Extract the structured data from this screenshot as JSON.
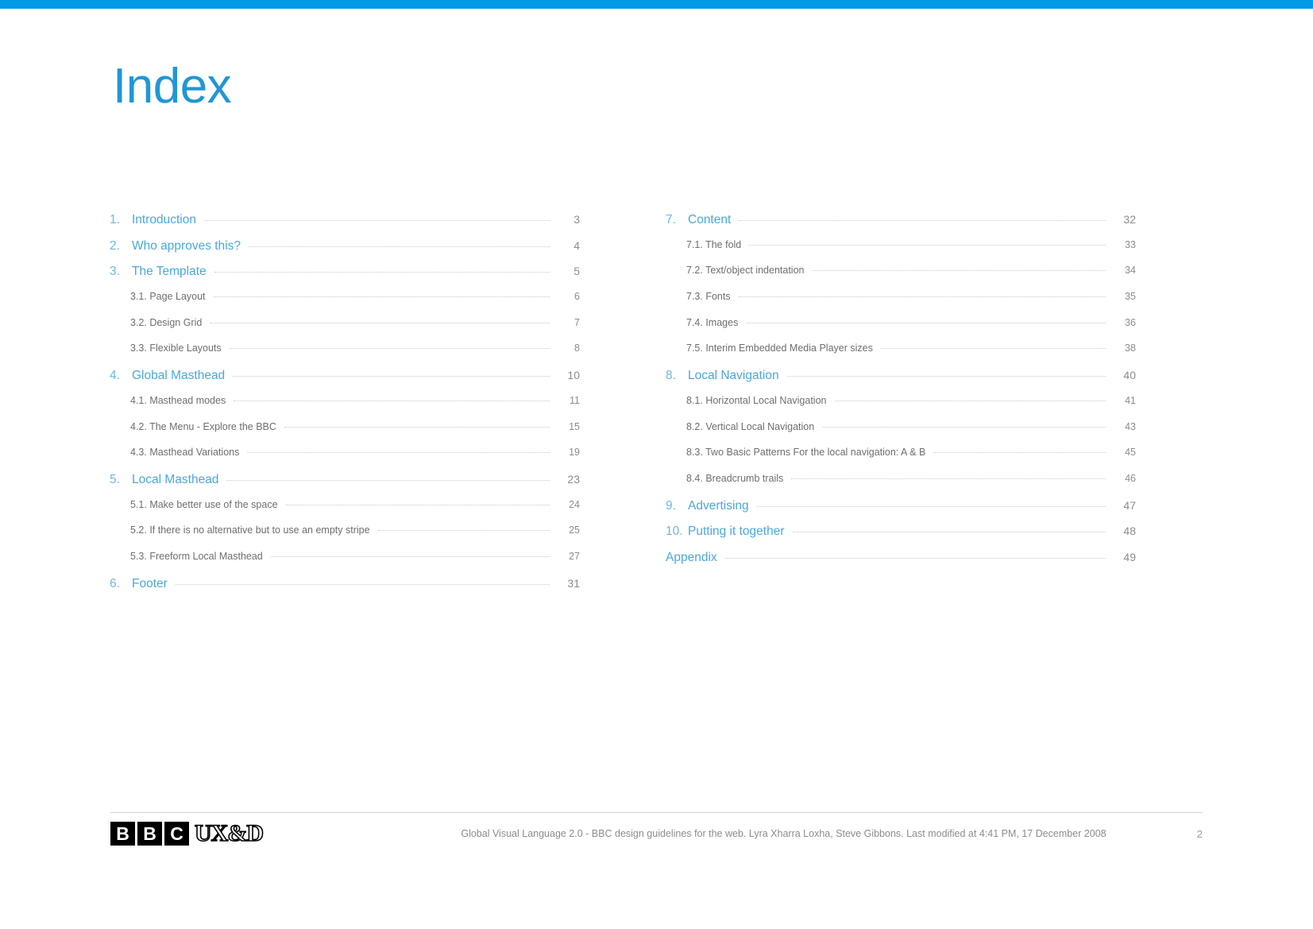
{
  "document": {
    "title": "Index",
    "accent_color": "#0099e5",
    "heading_color": "#2196d6",
    "entry_color": "#4aa8dd",
    "subentry_color": "#6d6e71"
  },
  "toc": {
    "left_column": [
      {
        "number": "1.",
        "label": "Introduction",
        "page": "3",
        "level": 1
      },
      {
        "number": "2.",
        "label": "Who approves this?",
        "page": "4",
        "level": 1
      },
      {
        "number": "3.",
        "label": "The Template",
        "page": "5",
        "level": 1
      },
      {
        "number": "3.1.",
        "label": "3.1. Page Layout",
        "page": "6",
        "level": 2
      },
      {
        "number": "3.2.",
        "label": "3.2. Design Grid",
        "page": "7",
        "level": 2
      },
      {
        "number": "3.3.",
        "label": "3.3. Flexible Layouts",
        "page": "8",
        "level": 2
      },
      {
        "number": "4.",
        "label": "Global Masthead",
        "page": "10",
        "level": 1
      },
      {
        "number": "4.1.",
        "label": "4.1. Masthead modes",
        "page": "11",
        "level": 2
      },
      {
        "number": "4.2.",
        "label": "4.2. The Menu - Explore the BBC",
        "page": "15",
        "level": 2
      },
      {
        "number": "4.3.",
        "label": "4.3. Masthead Variations",
        "page": "19",
        "level": 2
      },
      {
        "number": "5.",
        "label": "Local Masthead",
        "page": "23",
        "level": 1
      },
      {
        "number": "5.1.",
        "label": "5.1. Make better use of the space",
        "page": "24",
        "level": 2
      },
      {
        "number": "5.2.",
        "label": "5.2. If there is no alternative but to use an empty stripe",
        "page": "25",
        "level": 2
      },
      {
        "number": "5.3.",
        "label": "5.3. Freeform Local Masthead",
        "page": "27",
        "level": 2
      },
      {
        "number": "6.",
        "label": "Footer",
        "page": "31",
        "level": 1
      }
    ],
    "right_column": [
      {
        "number": "7.",
        "label": "Content",
        "page": "32",
        "level": 1
      },
      {
        "number": "7.1.",
        "label": "7.1. The fold",
        "page": "33",
        "level": 2
      },
      {
        "number": "7.2.",
        "label": "7.2. Text/object indentation",
        "page": "34",
        "level": 2
      },
      {
        "number": "7.3.",
        "label": "7.3. Fonts",
        "page": "35",
        "level": 2
      },
      {
        "number": "7.4.",
        "label": "7.4. Images",
        "page": "36",
        "level": 2
      },
      {
        "number": "7.5.",
        "label": "7.5. Interim Embedded Media Player sizes",
        "page": "38",
        "level": 2
      },
      {
        "number": "8.",
        "label": "Local Navigation",
        "page": "40",
        "level": 1
      },
      {
        "number": "8.1.",
        "label": "8.1. Horizontal Local Navigation",
        "page": "41",
        "level": 2
      },
      {
        "number": "8.2.",
        "label": "8.2. Vertical Local Navigation",
        "page": "43",
        "level": 2
      },
      {
        "number": "8.3.",
        "label": "8.3. Two Basic Patterns For the local navigation: A & B",
        "page": "45",
        "level": 2
      },
      {
        "number": "8.4.",
        "label": "8.4. Breadcrumb trails",
        "page": "46",
        "level": 2
      },
      {
        "number": "9.",
        "label": "Advertising",
        "page": "47",
        "level": 1
      },
      {
        "number": "10.",
        "label": "Putting it together",
        "page": "48",
        "level": 1
      },
      {
        "number": "",
        "label": "Appendix",
        "page": "49",
        "level": 1
      }
    ]
  },
  "footer": {
    "logo_letters": [
      "B",
      "B",
      "C"
    ],
    "logo_suffix": "UX&D",
    "credit": "Global Visual Language 2.0 - BBC design guidelines for the web. Lyra Xharra Loxha, Steve Gibbons. Last modified at 4:41 PM, 17 December 2008",
    "page_number": "2"
  }
}
